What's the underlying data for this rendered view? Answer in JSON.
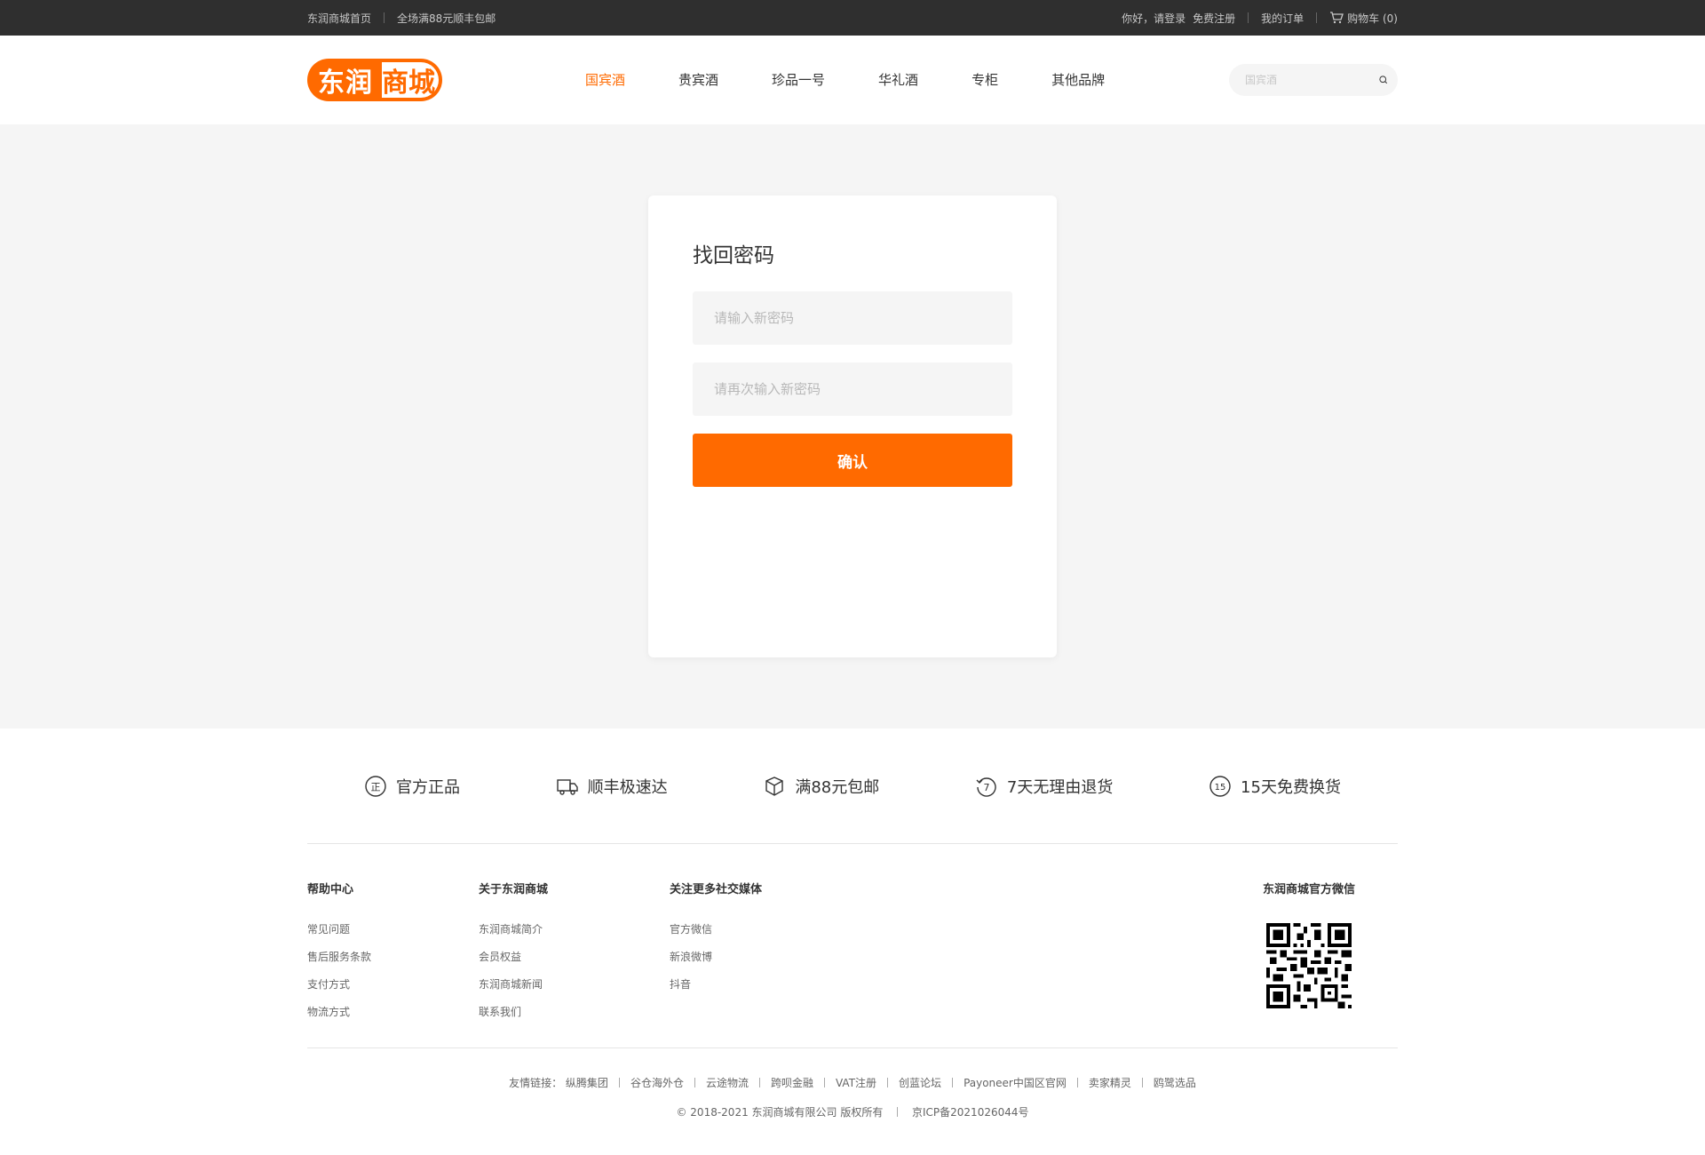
{
  "topbar": {
    "home": "东润商城首页",
    "promo": "全场满88元顺丰包邮",
    "greeting": "你好，请登录",
    "register": "免费注册",
    "orders": "我的订单",
    "cart": "购物车 (0)"
  },
  "header": {
    "logo_part1": "东润",
    "logo_part2": "商城",
    "nav": [
      "国宾酒",
      "贵宾酒",
      "珍品一号",
      "华礼酒",
      "专柜",
      "其他品牌"
    ],
    "search_placeholder": "国宾酒"
  },
  "form": {
    "title": "找回密码",
    "new_password_placeholder": "请输入新密码",
    "confirm_password_placeholder": "请再次输入新密码",
    "confirm_button": "确认"
  },
  "features": [
    "官方正品",
    "顺丰极速达",
    "满88元包邮",
    "7天无理由退货",
    "15天免费换货"
  ],
  "footer": {
    "help": {
      "title": "帮助中心",
      "links": [
        "常见问题",
        "售后服务条款",
        "支付方式",
        "物流方式"
      ]
    },
    "about": {
      "title": "关于东润商城",
      "links": [
        "东润商城简介",
        "会员权益",
        "东润商城新闻",
        "联系我们"
      ]
    },
    "social": {
      "title": "关注更多社交媒体",
      "links": [
        "官方微信",
        "新浪微博",
        "抖音"
      ]
    },
    "wechat_title": "东润商城官方微信",
    "friend_label": "友情链接：",
    "friend_links": [
      "纵腾集团",
      "谷仓海外仓",
      "云途物流",
      "跨呗金融",
      "VAT注册",
      "创蓝论坛",
      "Payoneer中国区官网",
      "卖家精灵",
      "鸥鹭选品"
    ],
    "copyright": "© 2018-2021 东润商城有限公司 版权所有",
    "icp": "京ICP备2021026044号"
  },
  "colors": {
    "accent": "#ff6a00",
    "topbar": "#2f2f2f",
    "background": "#f5f5f5"
  }
}
